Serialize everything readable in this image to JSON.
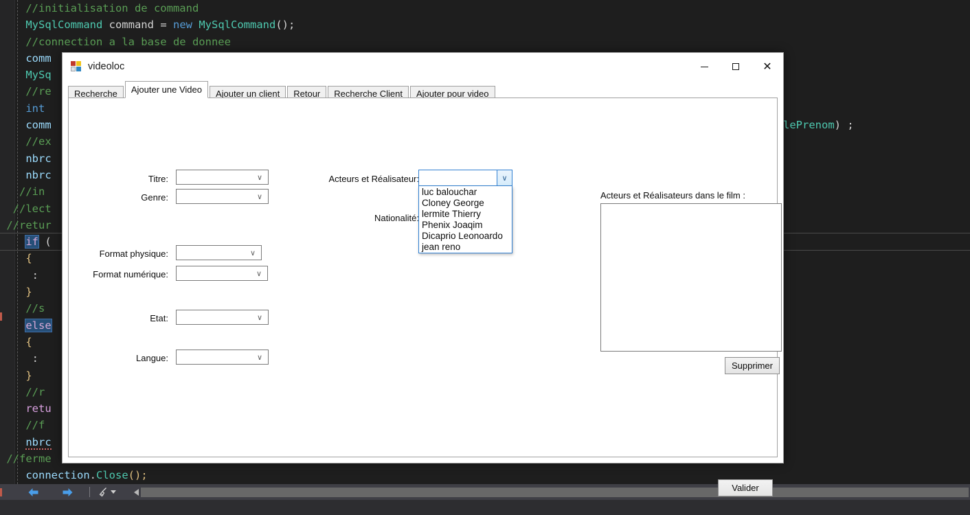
{
  "editor": {
    "lines": [
      [
        {
          "t": "    ",
          "c": "pl"
        },
        {
          "t": "//initialisation de command",
          "c": "cm"
        }
      ],
      [
        {
          "t": "    ",
          "c": "pl"
        },
        {
          "t": "MySqlCommand",
          "c": "ty"
        },
        {
          "t": " command ",
          "c": "pl"
        },
        {
          "t": "= ",
          "c": "pl"
        },
        {
          "t": "new",
          "c": "kw"
        },
        {
          "t": " ",
          "c": "pl"
        },
        {
          "t": "MySqlCommand",
          "c": "ty"
        },
        {
          "t": "();",
          "c": "pl"
        }
      ],
      [
        {
          "t": "    ",
          "c": "pl"
        },
        {
          "t": "//connection a la base de donnee",
          "c": "cm"
        }
      ],
      [
        {
          "t": "    ",
          "c": "pl"
        },
        {
          "t": "comm",
          "c": "id"
        }
      ],
      [
        {
          "t": "    ",
          "c": "pl"
        },
        {
          "t": "MySq",
          "c": "ty"
        }
      ],
      [
        {
          "t": "    ",
          "c": "pl"
        },
        {
          "t": "//re",
          "c": "cm"
        }
      ],
      [
        {
          "t": "    ",
          "c": "pl"
        },
        {
          "t": "int",
          "c": "kw"
        }
      ],
      [
        {
          "t": "    ",
          "c": "pl"
        },
        {
          "t": "comm",
          "c": "id"
        }
      ],
      [
        {
          "t": "    ",
          "c": "pl"
        },
        {
          "t": "//ex",
          "c": "cm"
        }
      ],
      [
        {
          "t": "    ",
          "c": "pl"
        },
        {
          "t": "nbrc",
          "c": "id"
        }
      ],
      [
        {
          "t": "    ",
          "c": "pl"
        },
        {
          "t": "nbrc",
          "c": "id"
        }
      ],
      [
        {
          "t": "   ",
          "c": "pl"
        },
        {
          "t": "//in",
          "c": "cm"
        }
      ],
      [
        {
          "t": "  ",
          "c": "pl"
        },
        {
          "t": "//lect",
          "c": "cm"
        }
      ],
      [
        {
          "t": " ",
          "c": "pl"
        },
        {
          "t": "//retur",
          "c": "cm"
        }
      ],
      [
        {
          "t": "    ",
          "c": "pl"
        },
        {
          "t": "if",
          "c": "sel"
        },
        {
          "t": " (",
          "c": "pl"
        }
      ],
      [
        {
          "t": "    ",
          "c": "pl"
        },
        {
          "t": "{",
          "c": "pn"
        }
      ],
      [
        {
          "t": "     ",
          "c": "pl"
        },
        {
          "t": ":",
          "c": "pl"
        }
      ],
      [
        {
          "t": "    ",
          "c": "pl"
        },
        {
          "t": "}",
          "c": "pn"
        }
      ],
      [
        {
          "t": "    ",
          "c": "pl"
        },
        {
          "t": "//s",
          "c": "cm"
        }
      ],
      [
        {
          "t": "    ",
          "c": "pl"
        },
        {
          "t": "else",
          "c": "sel"
        }
      ],
      [
        {
          "t": "    ",
          "c": "pl"
        },
        {
          "t": "{",
          "c": "pn"
        }
      ],
      [
        {
          "t": "     ",
          "c": "pl"
        },
        {
          "t": ":",
          "c": "pl"
        }
      ],
      [
        {
          "t": "    ",
          "c": "pl"
        },
        {
          "t": "}",
          "c": "pn"
        }
      ],
      [
        {
          "t": "    ",
          "c": "pl"
        },
        {
          "t": "//r",
          "c": "cm"
        }
      ],
      [
        {
          "t": "    ",
          "c": "pl"
        },
        {
          "t": "retu",
          "c": "kwm"
        }
      ],
      [
        {
          "t": "    ",
          "c": "pl"
        },
        {
          "t": "//f",
          "c": "cm"
        }
      ],
      [
        {
          "t": "    ",
          "c": "pl"
        },
        {
          "t": "nbrc",
          "c": "sq"
        }
      ],
      [
        {
          "t": " ",
          "c": "pl"
        },
        {
          "t": "//ferme",
          "c": "cm"
        }
      ],
      [
        {
          "t": "    ",
          "c": "pl"
        },
        {
          "t": "connection",
          "c": "id"
        },
        {
          "t": ".",
          "c": "pl"
        },
        {
          "t": "Close",
          "c": "ty"
        },
        {
          "t": "();",
          "c": "pn"
        }
      ],
      [
        {
          "t": "}",
          "c": "pn"
        }
      ]
    ],
    "right_fragment": [
      {
        "t": "lePrenom",
        "c": "ty"
      },
      {
        "t": ") ;",
        "c": "pl"
      }
    ]
  },
  "bottombar": {
    "back_icon": "back-arrow-icon",
    "forward_icon": "forward-arrow-icon",
    "broom_icon": "broom-icon",
    "dropdown_icon": "chevron-down-icon",
    "scroll_left_icon": "scroll-left-arrow-icon"
  },
  "window": {
    "title": "videoloc",
    "icon": "winforms-app-icon",
    "minimize_label": "minimize-button",
    "maximize_label": "maximize-button",
    "close_label": "✕"
  },
  "tabs": [
    {
      "label": "Recherche",
      "active": false
    },
    {
      "label": "Ajouter une Video",
      "active": true
    },
    {
      "label": "Ajouter un client",
      "active": false
    },
    {
      "label": "Retour",
      "active": false
    },
    {
      "label": "Recherche Client",
      "active": false
    },
    {
      "label": "Ajouter pour video",
      "active": false
    }
  ],
  "form": {
    "labels": {
      "titre": "Titre:",
      "genre": "Genre:",
      "format_physique": "Format physique:",
      "format_numerique": "Format numérique:",
      "etat": "Etat:",
      "langue": "Langue:",
      "acteurs_realisateur": "Acteurs et Réalisateur:",
      "nationalite": "Nationalité:",
      "listbox_title": "Acteurs et Réalisateurs dans le film :"
    },
    "values": {
      "titre": "",
      "genre": "",
      "format_physique": "",
      "format_numerique": "",
      "etat": "",
      "langue": "",
      "acteurs_realisateur": "",
      "nationalite": ""
    },
    "chevron": "∨",
    "dropdown_open": true,
    "dropdown_options": [
      "luc balouchar",
      "Cloney George",
      "lermite Thierry",
      "Phenix Joaqim",
      "Dicaprio Leonoardo",
      "jean reno"
    ],
    "listbox_items": [],
    "buttons": {
      "supprimer": "Supprimer",
      "valider": "Valider"
    }
  },
  "colors": {
    "editor_bg": "#1e1e1e",
    "comment_green": "#5a9e55",
    "type_teal": "#4ec9b0",
    "keyword_blue": "#569cd6",
    "identifier_blue": "#9cdcfe",
    "selection_blue": "#264f78",
    "accent_blue": "#2f7fd1",
    "form_bg": "#ffffff",
    "tab_inactive": "#f0f0f0"
  }
}
